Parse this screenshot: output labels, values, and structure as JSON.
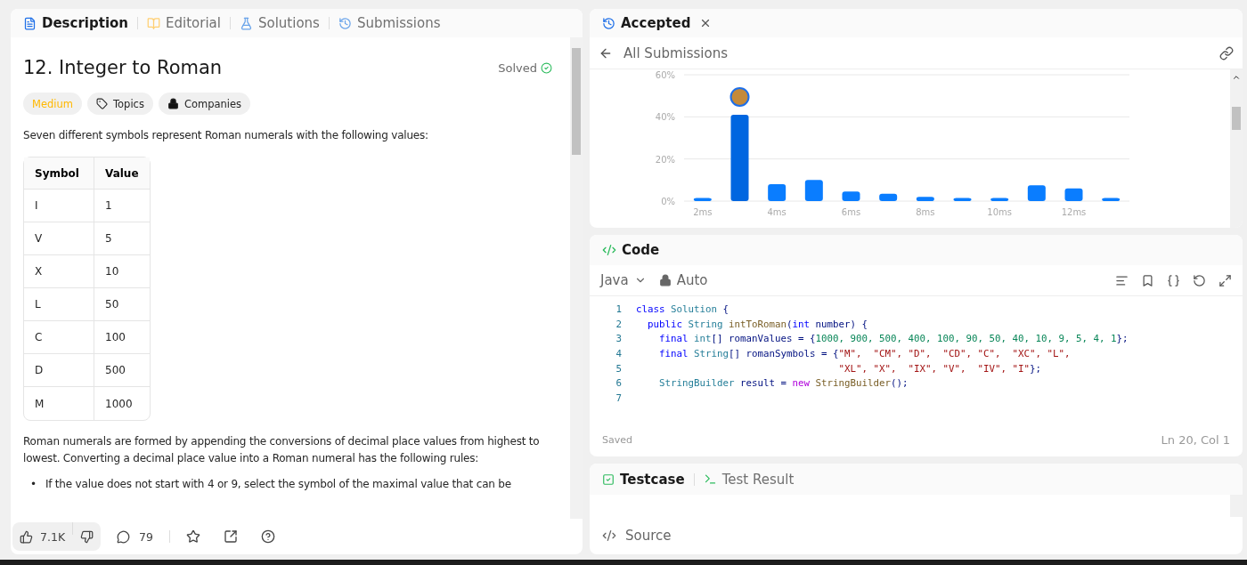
{
  "description_panel": {
    "tabs": [
      {
        "label": "Description",
        "selected": true
      },
      {
        "label": "Editorial",
        "selected": false
      },
      {
        "label": "Solutions",
        "selected": false
      },
      {
        "label": "Submissions",
        "selected": false
      }
    ],
    "title": "12. Integer to Roman",
    "status": "Solved",
    "tags": [
      {
        "label": "Medium",
        "kind": "difficulty"
      },
      {
        "label": "Topics",
        "kind": "tag"
      },
      {
        "label": "Companies",
        "kind": "lock"
      }
    ],
    "intro": "Seven different symbols represent Roman numerals with the following values:",
    "table": {
      "columns": [
        "Symbol",
        "Value"
      ],
      "rows": [
        [
          "I",
          "1"
        ],
        [
          "V",
          "5"
        ],
        [
          "X",
          "10"
        ],
        [
          "L",
          "50"
        ],
        [
          "C",
          "100"
        ],
        [
          "D",
          "500"
        ],
        [
          "M",
          "1000"
        ]
      ]
    },
    "paragraph": "Roman numerals are formed by appending the conversions of decimal place values from highest to lowest. Converting a decimal place value into a Roman numeral has the following rules:",
    "bullets": [
      {
        "marker": "•",
        "text": "If the value does not start with 4 or 9, select the symbol of the maximal value that can be"
      }
    ],
    "footer": {
      "likes": "7.1K",
      "comments": "79"
    }
  },
  "result_panel": {
    "tab": {
      "label": "Accepted"
    },
    "back_label": "All Submissions",
    "chart_data": {
      "type": "bar",
      "x": [
        2,
        3,
        4,
        5,
        6,
        7,
        8,
        9,
        10,
        11,
        12,
        13
      ],
      "values": [
        1.5,
        41,
        8,
        10,
        4.5,
        3.5,
        2,
        1.5,
        1.5,
        7.5,
        6,
        1.5
      ],
      "xlim": [
        1.5,
        13.5
      ],
      "ylim": [
        0,
        60
      ],
      "yticks": [
        {
          "value": 0,
          "label": "0%"
        },
        {
          "value": 20,
          "label": "20%"
        },
        {
          "value": 40,
          "label": "40%"
        },
        {
          "value": 60,
          "label": "60%"
        }
      ],
      "xticks": [
        {
          "value": 2,
          "label": "2ms"
        },
        {
          "value": 4,
          "label": "4ms"
        },
        {
          "value": 6,
          "label": "6ms"
        },
        {
          "value": 8,
          "label": "8ms"
        },
        {
          "value": 10,
          "label": "10ms"
        },
        {
          "value": 12,
          "label": "12ms"
        }
      ]
    }
  },
  "code_panel": {
    "title": "Code",
    "language": "Java",
    "mode": "Auto",
    "lines": [
      {
        "number": "1",
        "tokens": [
          {
            "kind": "keyword",
            "text": "class"
          },
          {
            "kind": "type",
            "text": " Solution"
          },
          {
            "kind": "plain",
            "text": " {"
          }
        ]
      },
      {
        "number": "2",
        "tokens": [
          {
            "kind": "keyword",
            "text": "  public"
          },
          {
            "kind": "type",
            "text": " String"
          },
          {
            "kind": "function",
            "text": " intToRoman"
          },
          {
            "kind": "plain",
            "text": "("
          },
          {
            "kind": "keyword",
            "text": "int"
          },
          {
            "kind": "plain",
            "text": " number) {"
          }
        ]
      },
      {
        "number": "3",
        "tokens": [
          {
            "kind": "keyword",
            "text": "    final"
          },
          {
            "kind": "type",
            "text": " int"
          },
          {
            "kind": "plain",
            "text": "[] romanValues = {"
          },
          {
            "kind": "number",
            "text": "1000, 900, 500, 400, 100, 90, 50, 40, 10, 9, 5, 4, 1"
          },
          {
            "kind": "plain",
            "text": "};"
          }
        ]
      },
      {
        "number": "4",
        "tokens": [
          {
            "kind": "keyword",
            "text": "    final"
          },
          {
            "kind": "type",
            "text": " String"
          },
          {
            "kind": "plain",
            "text": "[] romanSymbols = {"
          },
          {
            "kind": "string",
            "text": "\"M\",  \"CM\", \"D\",  \"CD\", \"C\",  \"XC\", \"L\","
          }
        ]
      },
      {
        "number": "5",
        "tokens": [
          {
            "kind": "string",
            "text": "                                   \"XL\", \"X\",  \"IX\", \"V\",  \"IV\", \"I\""
          },
          {
            "kind": "plain",
            "text": "};"
          }
        ]
      },
      {
        "number": "6",
        "tokens": [
          {
            "kind": "type",
            "text": "    StringBuilder"
          },
          {
            "kind": "plain",
            "text": " result = "
          },
          {
            "kind": "control",
            "text": "new"
          },
          {
            "kind": "function",
            "text": " StringBuilder"
          },
          {
            "kind": "plain",
            "text": "();"
          }
        ]
      },
      {
        "number": "7"
      }
    ],
    "save_status": "Saved",
    "cursor": "Ln 20, Col 1"
  },
  "test_panel": {
    "tabs": [
      {
        "label": "Testcase",
        "selected": true
      },
      {
        "label": "Test Result",
        "selected": false
      }
    ],
    "source_label": "Source"
  }
}
